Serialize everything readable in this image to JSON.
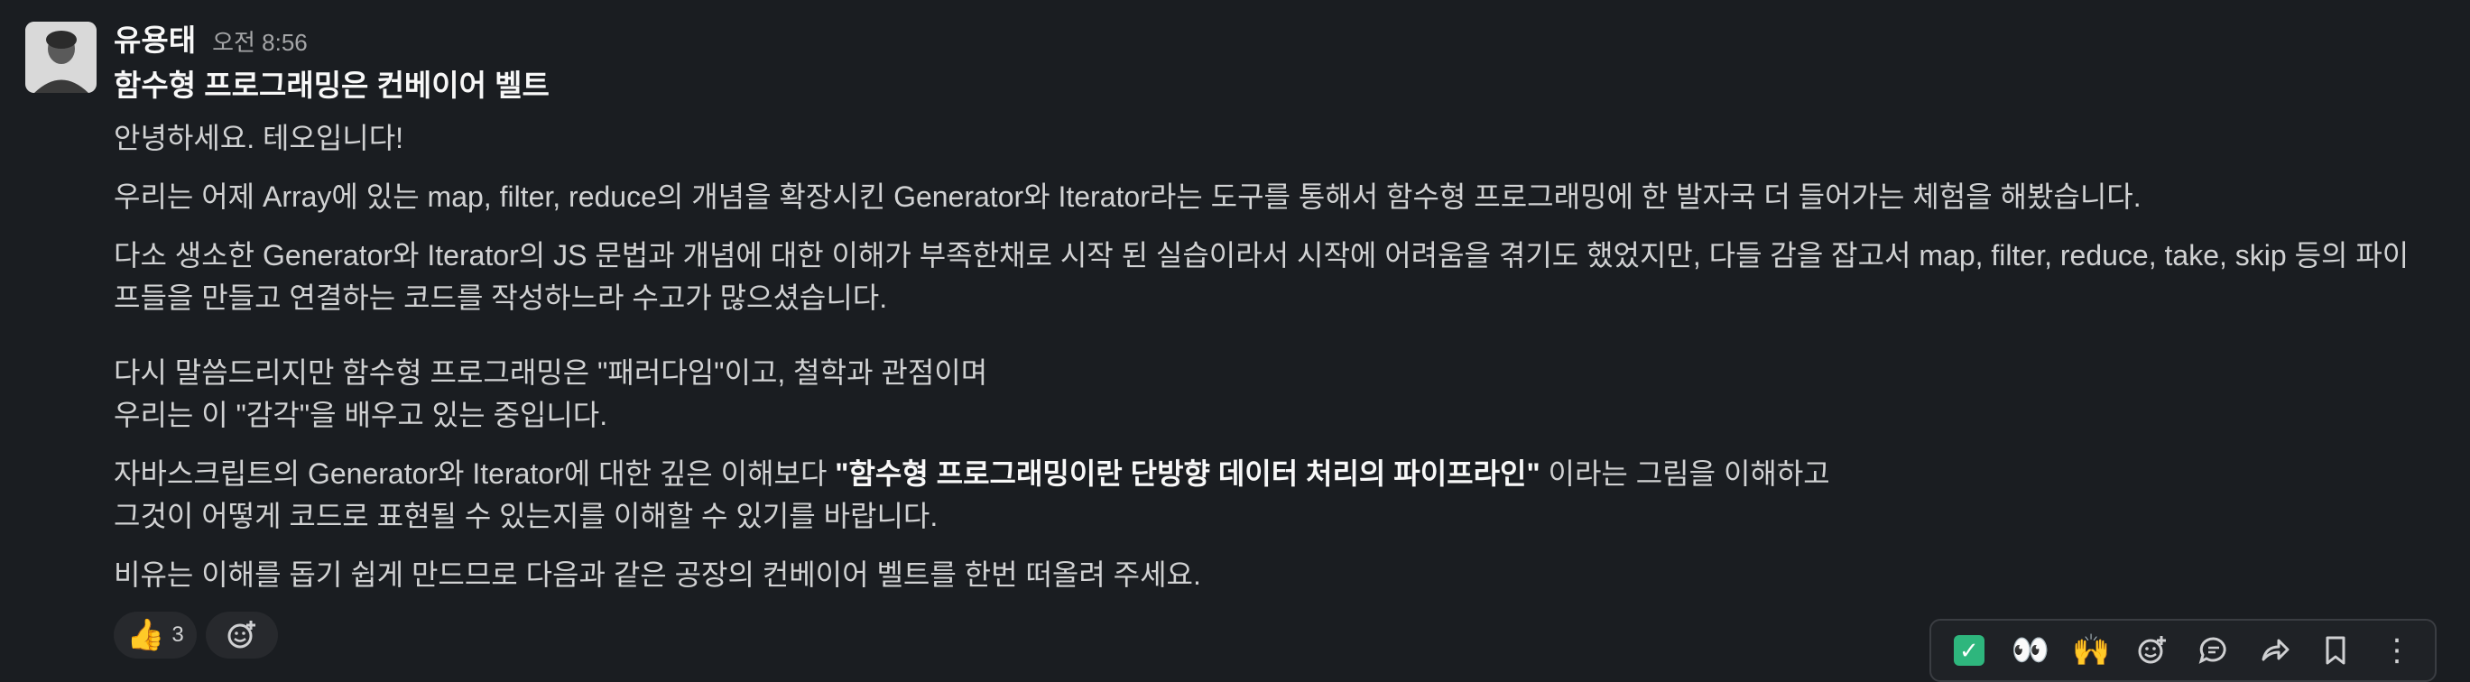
{
  "message": {
    "sender": "유용태",
    "timestamp": "오전 8:56",
    "title": "함수형 프로그래밍은 컨베이어 벨트",
    "paragraphs": [
      "안녕하세요. 테오입니다!",
      "우리는 어제 Array에 있는 map, filter, reduce의 개념을 확장시킨 Generator와 Iterator라는 도구를 통해서 함수형 프로그래밍에 한 발자국 더 들어가는 체험을 해봤습니다.",
      "다소 생소한 Generator와 Iterator의 JS 문법과 개념에 대한 이해가 부족한채로 시작 된 실습이라서 시작에 어려움을 겪기도 했었지만, 다들 감을 잡고서 map, filter, reduce, take, skip 등의 파이프들을 만들고 연결하는 코드를 작성하느라 수고가 많으셨습니다."
    ],
    "para4_line1": "다시 말씀드리지만 함수형 프로그래밍은 \"패러다임\"이고, 철학과 관점이며",
    "para4_line2": "우리는 이 \"감각\"을 배우고 있는 중입니다.",
    "para5_prefix": "자바스크립트의 Generator와 Iterator에 대한 깊은 이해보다 ",
    "para5_bold": "\"함수형 프로그래밍이란 단방향 데이터 처리의 파이프라인\"",
    "para5_suffix": " 이라는 그림을 이해하고",
    "para5_line2": "그것이 어떻게 코드로 표현될 수 있는지를 이해할 수 있기를 바랍니다.",
    "para6": "비유는 이해를 돕기 쉽게 만드므로 다음과 같은 공장의 컨베이어 벨트를 한번 떠올려 주세요."
  },
  "reactions": [
    {
      "emoji": "👍",
      "icon": "thumbs-up-icon",
      "count": "3"
    }
  ],
  "add_reaction_icon": "add-reaction-icon",
  "toolbar": {
    "items": [
      {
        "icon": "white-check-mark-icon",
        "glyph": "✓"
      },
      {
        "icon": "eyes-icon",
        "glyph": "👀"
      },
      {
        "icon": "raised-hands-icon",
        "glyph": "🙌"
      },
      {
        "icon": "add-reaction-icon",
        "glyph": "☺"
      },
      {
        "icon": "reply-in-thread-icon",
        "glyph": "💬"
      },
      {
        "icon": "share-icon",
        "glyph": "↪"
      },
      {
        "icon": "bookmark-icon",
        "glyph": "🔖"
      },
      {
        "icon": "more-actions-icon",
        "glyph": "⋮"
      }
    ]
  },
  "colors": {
    "background": "#1a1d21",
    "text": "#d1d2d3",
    "accent_green": "#2eb67d"
  }
}
